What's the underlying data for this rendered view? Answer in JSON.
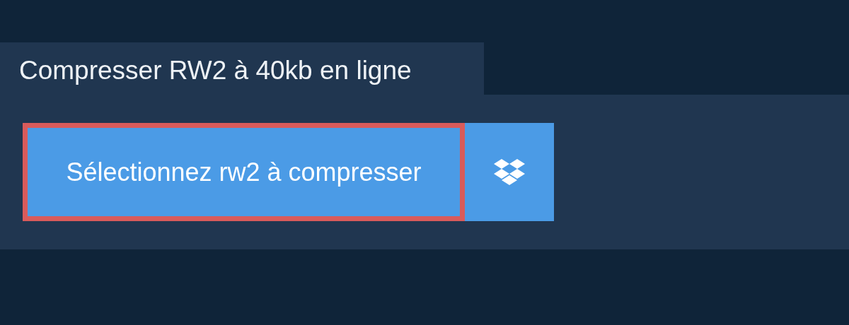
{
  "tab": {
    "title": "Compresser RW2 à 40kb en ligne"
  },
  "upload": {
    "label": "Sélectionnez rw2 à compresser",
    "focused": true
  }
}
